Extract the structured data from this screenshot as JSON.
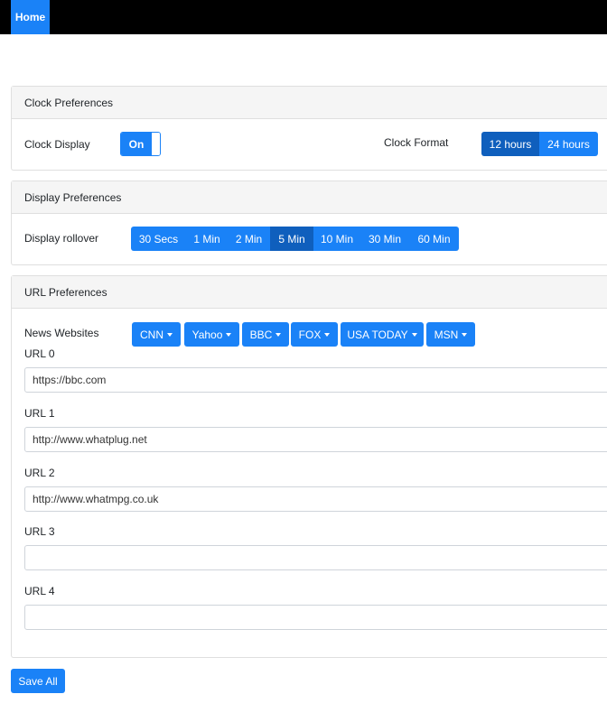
{
  "nav": {
    "home_label": "Home"
  },
  "clock": {
    "header": "Clock Preferences",
    "display_label": "Clock Display",
    "display_toggle": "On",
    "format_label": "Clock Format",
    "format_options": [
      "12 hours",
      "24 hours"
    ],
    "format_selected": "12 hours"
  },
  "display": {
    "header": "Display Preferences",
    "rollover_label": "Display rollover",
    "rollover_options": [
      "30 Secs",
      "1 Min",
      "2 Min",
      "5 Min",
      "10 Min",
      "30 Min",
      "60 Min"
    ],
    "rollover_selected": "5 Min"
  },
  "url": {
    "header": "URL Preferences",
    "news_label": "News Websites",
    "news_dropdowns": [
      "CNN",
      "Yahoo",
      "BBC",
      "FOX",
      "USA TODAY",
      "MSN"
    ],
    "fields": [
      {
        "label": "URL 0",
        "value": "https://bbc.com"
      },
      {
        "label": "URL 1",
        "value": "http://www.whatplug.net"
      },
      {
        "label": "URL 2",
        "value": "http://www.whatmpg.co.uk"
      },
      {
        "label": "URL 3",
        "value": ""
      },
      {
        "label": "URL 4",
        "value": ""
      }
    ]
  },
  "save_label": "Save All",
  "colors": {
    "accent": "#1a82f7",
    "accent_active": "#0f5fbd",
    "navbar": "#000000"
  }
}
